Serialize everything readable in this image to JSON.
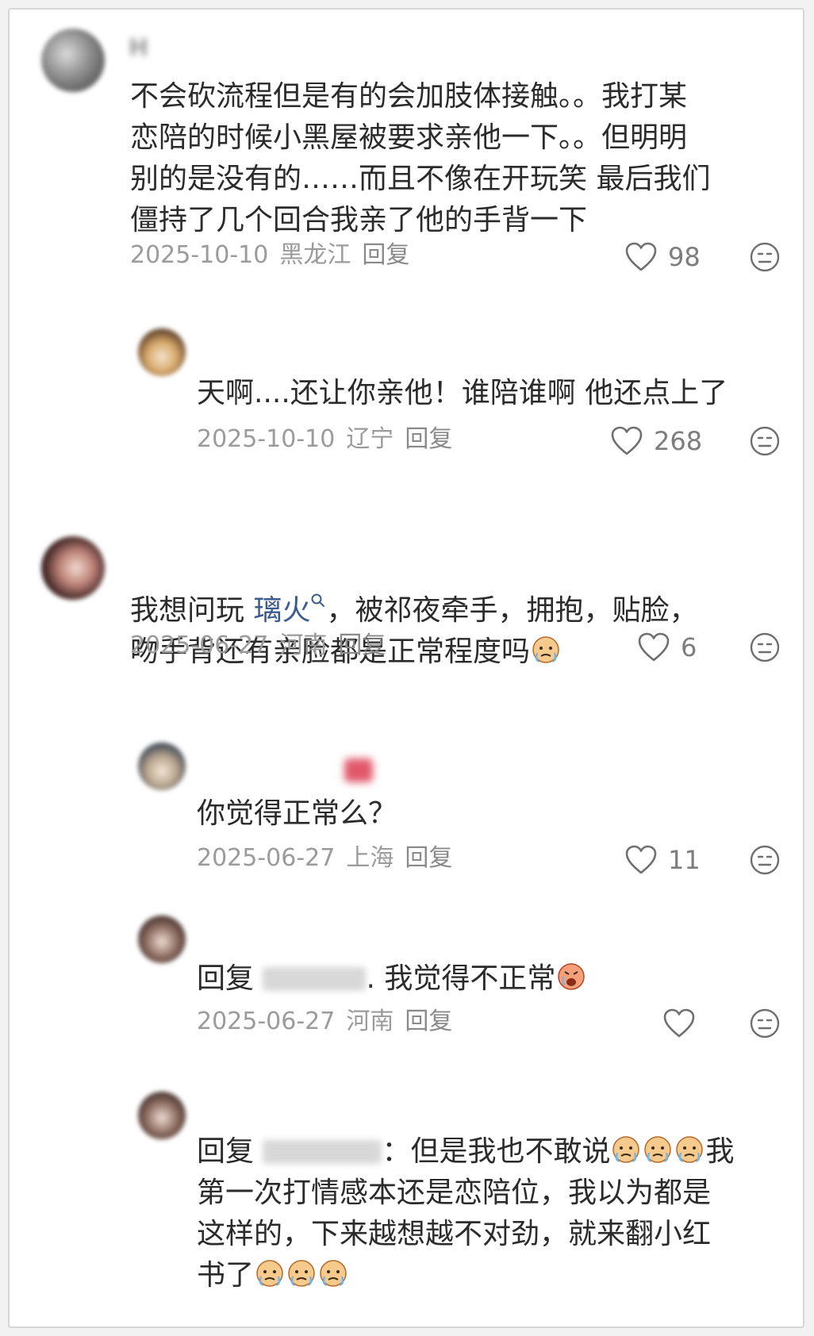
{
  "colors": {
    "text": "#2b2b2b",
    "meta": "#9b9b9b",
    "link": "#3b5c8f",
    "icon": "#6f6f6f"
  },
  "reply_label": "回复",
  "comments": [
    {
      "user": "H",
      "text": "不会砍流程但是有的会加肢体接触。。我打某\n恋陪的时候小黑屋被要求亲他一下。。但明明\n别的是没有的……而且不像在开玩笑 最后我们\n僵持了几个回合我亲了他的手背一下",
      "date": "2025-10-10",
      "location": "黑龙江",
      "likes": "98"
    },
    {
      "user": "",
      "text": "天啊....还让你亲他！谁陪谁啊 他还点上了",
      "date": "2025-10-10",
      "location": "辽宁",
      "likes": "268"
    },
    {
      "user": "",
      "text_before": "我想问玩 ",
      "topic": "璃火",
      "text_after": "，被祁夜牵手，拥抱，贴脸，\n吻手背还有亲脸都是正常程度吗",
      "date": "2025-06-27",
      "location": "河南",
      "likes": "6"
    },
    {
      "user": "",
      "text": "你觉得正常么？",
      "date": "2025-06-27",
      "location": "上海",
      "likes": "11"
    },
    {
      "user": "",
      "reply_prefix": "回复 ",
      "text_after": "我觉得不正常",
      "date": "2025-06-27",
      "location": "河南",
      "likes": ""
    },
    {
      "user": "",
      "reply_prefix": "回复 ",
      "text_after": "但是我也不敢说",
      "text_rest": "我\n第一次打情感本还是恋陪位，我以为都是\n这样的，下来越想越不对劲，就来翻小红\n书了",
      "date": "2025-06-27",
      "location": "河南",
      "likes": ""
    }
  ]
}
